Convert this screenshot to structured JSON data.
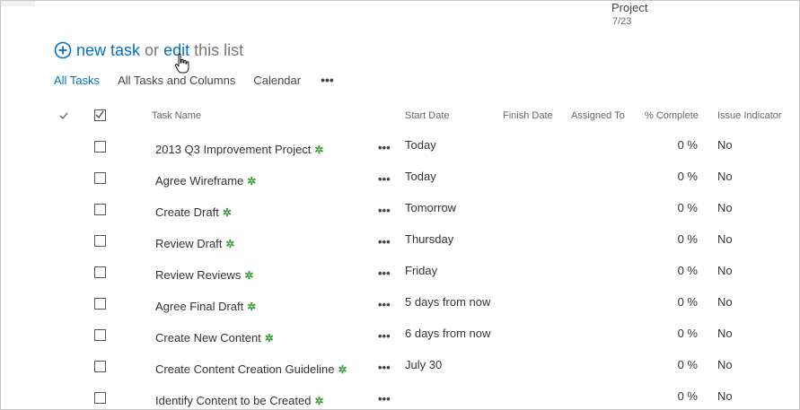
{
  "timeline": {
    "label": "Project",
    "date": "7/23"
  },
  "hero": {
    "new_task": "new task",
    "or": "or",
    "edit": "edit",
    "this_list": "this list"
  },
  "views": {
    "items": [
      "All Tasks",
      "All Tasks and Columns",
      "Calendar"
    ],
    "more": "•••",
    "active": "All Tasks"
  },
  "columns": {
    "task_name": "Task Name",
    "start_date": "Start Date",
    "finish_date": "Finish Date",
    "assigned_to": "Assigned To",
    "percent_complete": "% Complete",
    "issue_indicator": "Issue Indicator"
  },
  "icons": {
    "new_marker": "✲",
    "row_menu": "•••"
  },
  "colors": {
    "accent": "#0072c6",
    "new_marker": "#359b33"
  },
  "rows": [
    {
      "name": "2013 Q3 Improvement Project",
      "start": "Today",
      "pct": "0 %",
      "issue": "No"
    },
    {
      "name": "Agree Wireframe",
      "start": "Today",
      "pct": "0 %",
      "issue": "No"
    },
    {
      "name": "Create Draft",
      "start": "Tomorrow",
      "pct": "0 %",
      "issue": "No"
    },
    {
      "name": "Review Draft",
      "start": "Thursday",
      "pct": "0 %",
      "issue": "No"
    },
    {
      "name": "Review Reviews",
      "start": "Friday",
      "pct": "0 %",
      "issue": "No"
    },
    {
      "name": "Agree Final Draft",
      "start": "5 days from now",
      "pct": "0 %",
      "issue": "No"
    },
    {
      "name": "Create New Content",
      "start": "6 days from now",
      "pct": "0 %",
      "issue": "No"
    },
    {
      "name": "Create Content Creation Guideline",
      "start": "July 30",
      "pct": "0 %",
      "issue": "No"
    },
    {
      "name": "Identify Content to be Created",
      "start": "",
      "pct": "0 %",
      "issue": "No"
    }
  ]
}
